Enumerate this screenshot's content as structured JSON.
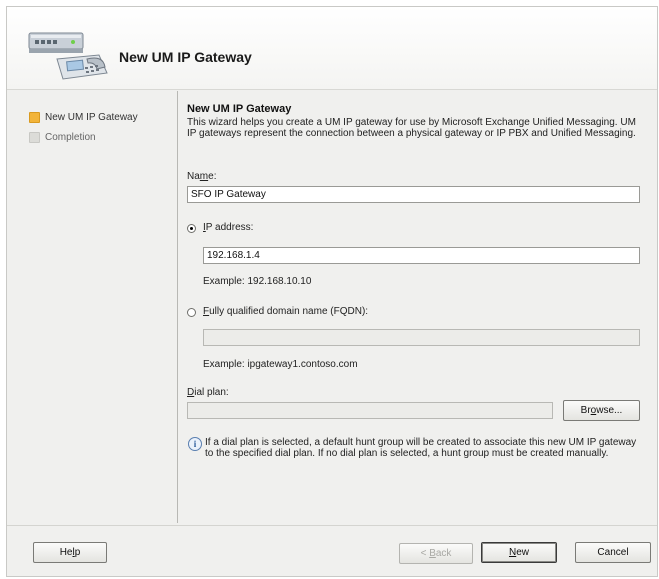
{
  "wizard": {
    "title": "New UM IP Gateway"
  },
  "steps": [
    {
      "label": "New UM IP Gateway",
      "state": "active"
    },
    {
      "label": "Completion",
      "state": "pending"
    }
  ],
  "content": {
    "section_title": "New UM IP Gateway",
    "description": "This wizard helps you create a UM IP gateway for use by Microsoft Exchange Unified Messaging. UM IP gateways represent the connection between a physical gateway or IP PBX and Unified Messaging.",
    "name_label_pre": "Na",
    "name_label_ul": "m",
    "name_label_post": "e:",
    "name_value": "SFO IP Gateway",
    "ip_label_ul": "I",
    "ip_label_rest": "P address:",
    "ip_value": "192.168.1.4",
    "ip_example": "Example: 192.168.10.10",
    "fqdn_label_ul": "F",
    "fqdn_label_rest": "ully qualified domain name (FQDN):",
    "fqdn_value": "",
    "fqdn_example": "Example: ipgateway1.contoso.com",
    "dialplan_label_ul": "D",
    "dialplan_label_rest": "ial plan:",
    "dialplan_value": "",
    "browse_pre": "Br",
    "browse_ul": "o",
    "browse_post": "wse...",
    "info_text": "If a dial plan is selected, a default hunt group will be created to associate this new UM IP gateway to the specified dial plan. If no dial plan is selected, a hunt group must be created manually."
  },
  "footer": {
    "help_pre": "He",
    "help_ul": "l",
    "help_post": "p",
    "back_pre": "< ",
    "back_ul": "B",
    "back_post": "ack",
    "new_ul": "N",
    "new_post": "ew",
    "cancel": "Cancel"
  }
}
